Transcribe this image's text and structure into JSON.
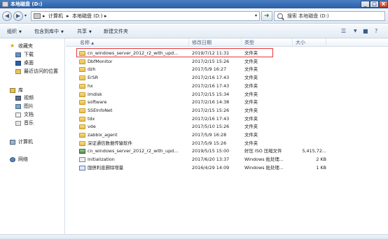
{
  "window": {
    "title": "本地磁盘 (D:)",
    "buttons": {
      "minimize": "_",
      "maximize": "□",
      "close": "X"
    }
  },
  "address_bar": {
    "crumbs": [
      "▸",
      "计算机",
      "▸",
      "本地磁盘 (D:)",
      "▸"
    ],
    "search_placeholder": "搜索 本地磁盘 (D:)"
  },
  "toolbar": {
    "organize": "组织",
    "include_in_library": "包含到库中",
    "share": "共享",
    "new_folder": "新建文件夹"
  },
  "nav": {
    "favorites": "收藏夹",
    "downloads": "下载",
    "desktop": "桌面",
    "recent": "最近访问的位置",
    "libraries": "库",
    "videos": "视频",
    "pictures": "图片",
    "documents": "文档",
    "music": "音乐",
    "computer": "计算机",
    "network": "网络"
  },
  "columns": {
    "name": "名称",
    "date": "修改日期",
    "type": "类型",
    "size": "大小"
  },
  "files": [
    {
      "name": "cn_windows_server_2012_r2_with_upd...",
      "date": "2019/7/12 11:31",
      "type": "文件夹",
      "size": "",
      "icon": "folder"
    },
    {
      "name": "DbfMonitor",
      "date": "2017/2/15 15:26",
      "type": "文件夹",
      "size": "",
      "icon": "folder"
    },
    {
      "name": "dzh",
      "date": "2017/5/9 16:27",
      "type": "文件夹",
      "size": "",
      "icon": "folder"
    },
    {
      "name": "ErSR",
      "date": "2017/2/16 17:43",
      "type": "文件夹",
      "size": "",
      "icon": "folder"
    },
    {
      "name": "hx",
      "date": "2017/2/16 17:43",
      "type": "文件夹",
      "size": "",
      "icon": "folder"
    },
    {
      "name": "imdisk",
      "date": "2017/2/15 15:34",
      "type": "文件夹",
      "size": "",
      "icon": "folder"
    },
    {
      "name": "software",
      "date": "2017/2/16 14:38",
      "type": "文件夹",
      "size": "",
      "icon": "folder"
    },
    {
      "name": "SSEInfoNet",
      "date": "2017/2/15 15:26",
      "type": "文件夹",
      "size": "",
      "icon": "folder"
    },
    {
      "name": "tdx",
      "date": "2017/2/16 17:43",
      "type": "文件夹",
      "size": "",
      "icon": "folder"
    },
    {
      "name": "vde",
      "date": "2017/5/10 15:26",
      "type": "文件夹",
      "size": "",
      "icon": "folder"
    },
    {
      "name": "zabbix_agent",
      "date": "2017/5/9 16:28",
      "type": "文件夹",
      "size": "",
      "icon": "folder"
    },
    {
      "name": "深证通信数据传输软件",
      "date": "2017/5/9 15:26",
      "type": "文件夹",
      "size": "",
      "icon": "folder"
    },
    {
      "name": "cn_windows_server_2012_r2_with_upd...",
      "date": "2019/5/15 15:00",
      "type": "好压 ISO 压缩文件",
      "size": "5,415,72...",
      "icon": "iso"
    },
    {
      "name": "initialization",
      "date": "2017/6/20 13:37",
      "type": "Windows 批处理...",
      "size": "2 KB",
      "icon": "bat"
    },
    {
      "name": "国债利息删除增量",
      "date": "2016/4/29 14:09",
      "type": "Windows 批处理...",
      "size": "1 KB",
      "icon": "bat2"
    }
  ]
}
